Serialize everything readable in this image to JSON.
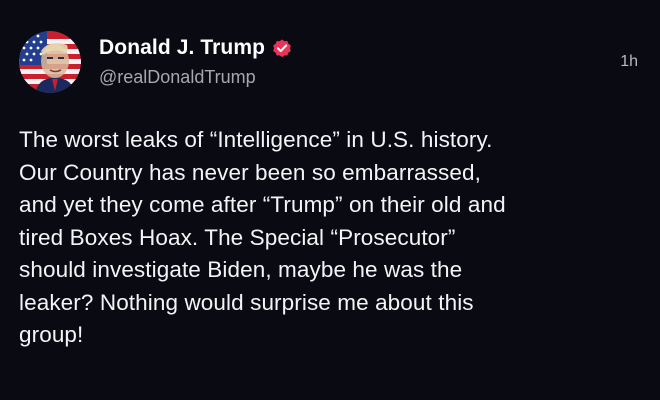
{
  "post": {
    "author": {
      "display_name": "Donald J. Trump",
      "handle": "@realDonaldTrump",
      "verified": true,
      "avatar_icon": "flag-portrait-avatar"
    },
    "timestamp": "1h",
    "text": "The worst leaks of “Intelligence” in U.S. history.\nOur Country has never been so embarrassed,\nand yet they come after “Trump” on their old and\ntired Boxes Hoax. The Special “Prosecutor”\nshould investigate Biden, maybe he was the\nleaker? Nothing would surprise me about this\ngroup!"
  },
  "colors": {
    "background": "#0a0a12",
    "text": "#f4f4f7",
    "secondary_text": "#a7a7b4",
    "verified_badge": "#e8345a"
  }
}
